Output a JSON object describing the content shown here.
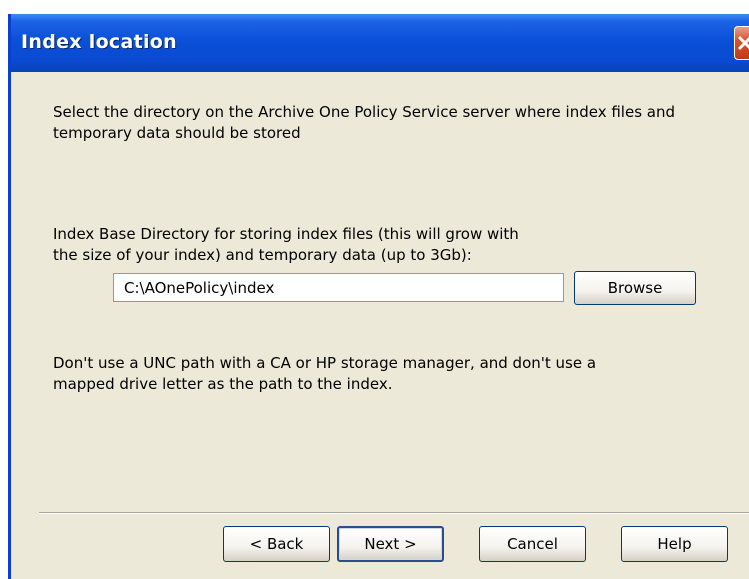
{
  "window": {
    "title": "Index location"
  },
  "content": {
    "instructions": "Select the directory on the Archive One Policy Service server where index files and temporary data should be stored",
    "dir_label_line1": "Index Base Directory for storing index files (this will grow with",
    "dir_label_line2": "the size of your index) and temporary data (up to 3Gb):",
    "path_value": "C:\\AOnePolicy\\index",
    "browse_label": "Browse",
    "warning_line1": "Don't use a UNC path with a CA or HP storage manager, and don't use a",
    "warning_line2": "mapped drive letter as the path to the index."
  },
  "buttons": {
    "back": "< Back",
    "next": "Next >",
    "cancel": "Cancel",
    "help": "Help"
  },
  "colors": {
    "titlebar": "#0a4ad2",
    "dialog_bg": "#ece9d8",
    "close_button": "#d8542e"
  }
}
